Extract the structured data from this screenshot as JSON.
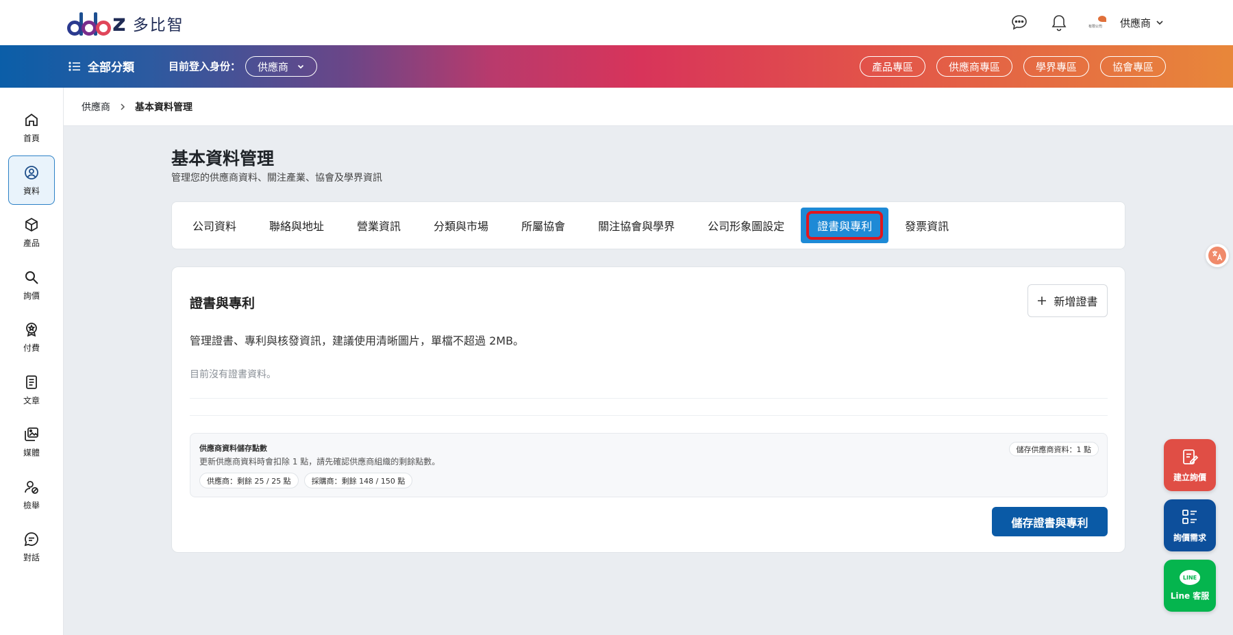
{
  "header": {
    "logo_text": "多比智",
    "user_name": "供應商",
    "user_logo_text": "有限公司"
  },
  "navbar": {
    "all_categories": "全部分類",
    "identity_label": "目前登入身份：",
    "identity_value": "供應商",
    "zones": [
      "產品專區",
      "供應商專區",
      "學界專區",
      "協會專區"
    ]
  },
  "sidebar": {
    "items": [
      {
        "label": "首頁",
        "icon": "home-icon"
      },
      {
        "label": "資料",
        "icon": "user-circle-icon"
      },
      {
        "label": "產品",
        "icon": "box-icon"
      },
      {
        "label": "詢價",
        "icon": "search-icon"
      },
      {
        "label": "付費",
        "icon": "badge-icon"
      },
      {
        "label": "文章",
        "icon": "document-icon"
      },
      {
        "label": "媒體",
        "icon": "media-icon"
      },
      {
        "label": "檢舉",
        "icon": "report-icon"
      },
      {
        "label": "對話",
        "icon": "chat-icon"
      }
    ],
    "active_index": 1
  },
  "breadcrumb": {
    "parent": "供應商",
    "current": "基本資料管理"
  },
  "page": {
    "title": "基本資料管理",
    "subtitle": "管理您的供應商資料、關注產業、協會及學界資訊"
  },
  "tabs": {
    "items": [
      "公司資料",
      "聯絡與地址",
      "營業資訊",
      "分類與市場",
      "所屬協會",
      "關注協會與學界",
      "公司形象圖設定",
      "證書與專利",
      "發票資訊"
    ],
    "active_index": 7
  },
  "card": {
    "title": "證書與專利",
    "add_button": "新增證書",
    "description": "管理證書、專利與核發資訊，建議使用清晰圖片，單檔不超過 2MB。",
    "empty_text": "目前沒有證書資料。",
    "points": {
      "title": "供應商資料儲存點數",
      "description": "更新供應商資料時會扣除 1 點，請先確認供應商組織的剩餘點數。",
      "cost": "儲存供應商資料：1 點",
      "supplier": "供應商：剩餘 25 / 25 點",
      "buyer": "採購商：剩餘 148 / 150 點"
    },
    "save_button": "儲存證書與專利"
  },
  "floating": {
    "translate_icon": "translate-icon",
    "create_inquiry": "建立詢價",
    "inquiry_needs": "詢價需求",
    "line_service": "Line 客服",
    "line_badge": "LINE"
  },
  "colors": {
    "primary": "#0a5aa6",
    "tab_active": "#1e8ad6",
    "highlight": "#e0161d",
    "fab_red": "#e04e45",
    "fab_blue": "#0d4f9b",
    "fab_green": "#05b54e"
  }
}
